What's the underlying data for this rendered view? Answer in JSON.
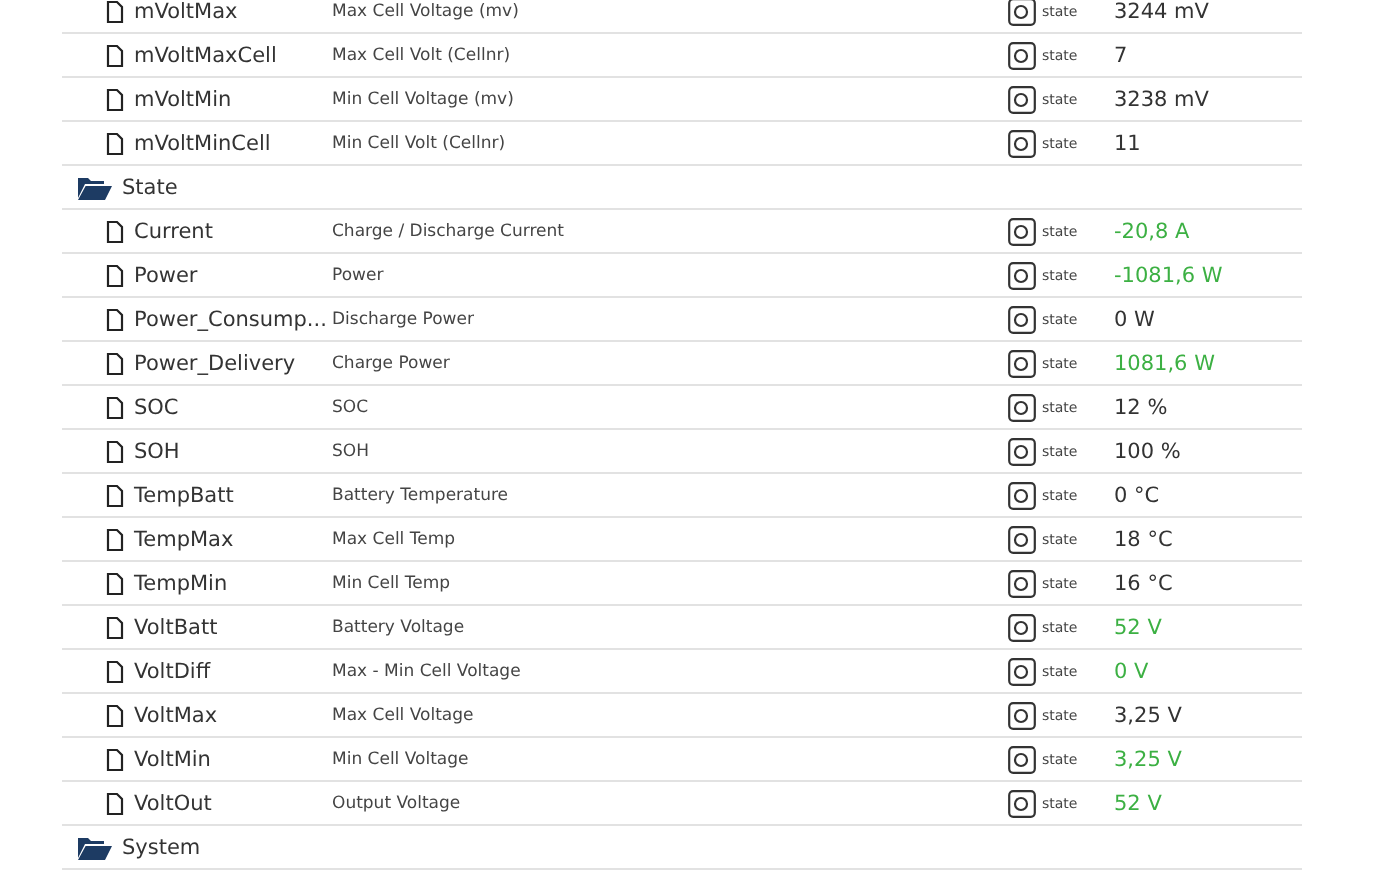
{
  "tree": [
    {
      "kind": "state",
      "name": "mVoltMax",
      "description": "Max Cell Voltage (mv)",
      "role": "state",
      "value": "3244 mV",
      "color": "#333333"
    },
    {
      "kind": "state",
      "name": "mVoltMaxCell",
      "description": "Max Cell Volt (Cellnr)",
      "role": "state",
      "value": "7",
      "color": "#333333"
    },
    {
      "kind": "state",
      "name": "mVoltMin",
      "description": "Min Cell Voltage (mv)",
      "role": "state",
      "value": "3238 mV",
      "color": "#333333"
    },
    {
      "kind": "state",
      "name": "mVoltMinCell",
      "description": "Min Cell Volt (Cellnr)",
      "role": "state",
      "value": "11",
      "color": "#333333"
    },
    {
      "kind": "folder",
      "name": "State",
      "expanded": true,
      "children": [
        {
          "kind": "state",
          "name": "Current",
          "description": "Charge / Discharge Current",
          "role": "state",
          "value": "-20,8 A",
          "color": "#3cb043"
        },
        {
          "kind": "state",
          "name": "Power",
          "description": "Power",
          "role": "state",
          "value": "-1081,6 W",
          "color": "#3cb043"
        },
        {
          "kind": "state",
          "name": "Power_Consump...",
          "description": "Discharge Power",
          "role": "state",
          "value": "0 W",
          "color": "#333333"
        },
        {
          "kind": "state",
          "name": "Power_Delivery",
          "description": "Charge Power",
          "role": "state",
          "value": "1081,6 W",
          "color": "#3cb043"
        },
        {
          "kind": "state",
          "name": "SOC",
          "description": "SOC",
          "role": "state",
          "value": "12 %",
          "color": "#333333"
        },
        {
          "kind": "state",
          "name": "SOH",
          "description": "SOH",
          "role": "state",
          "value": "100 %",
          "color": "#333333"
        },
        {
          "kind": "state",
          "name": "TempBatt",
          "description": "Battery Temperature",
          "role": "state",
          "value": "0 °C",
          "color": "#333333"
        },
        {
          "kind": "state",
          "name": "TempMax",
          "description": "Max Cell Temp",
          "role": "state",
          "value": "18 °C",
          "color": "#333333"
        },
        {
          "kind": "state",
          "name": "TempMin",
          "description": "Min Cell Temp",
          "role": "state",
          "value": "16 °C",
          "color": "#333333"
        },
        {
          "kind": "state",
          "name": "VoltBatt",
          "description": "Battery Voltage",
          "role": "state",
          "value": "52 V",
          "color": "#3cb043"
        },
        {
          "kind": "state",
          "name": "VoltDiff",
          "description": "Max - Min Cell Voltage",
          "role": "state",
          "value": "0 V",
          "color": "#3cb043"
        },
        {
          "kind": "state",
          "name": "VoltMax",
          "description": "Max Cell Voltage",
          "role": "state",
          "value": "3,25 V",
          "color": "#333333"
        },
        {
          "kind": "state",
          "name": "VoltMin",
          "description": "Min Cell Voltage",
          "role": "state",
          "value": "3,25 V",
          "color": "#3cb043"
        },
        {
          "kind": "state",
          "name": "VoltOut",
          "description": "Output Voltage",
          "role": "state",
          "value": "52 V",
          "color": "#3cb043"
        }
      ]
    },
    {
      "kind": "folder",
      "name": "System",
      "expanded": true
    }
  ]
}
